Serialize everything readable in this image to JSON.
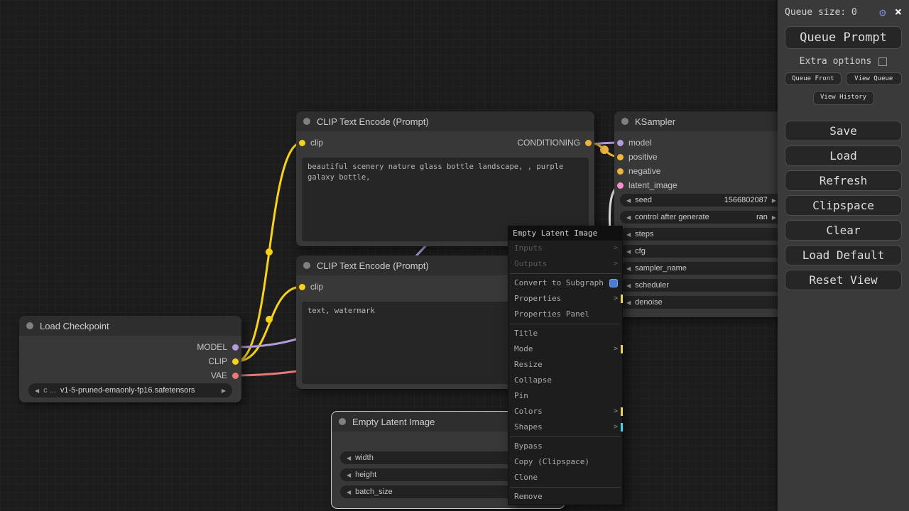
{
  "icons": {
    "gear": "⚙",
    "close": "×",
    "arrow_left": "◀",
    "arrow_right": "▶",
    "submenu_arrow": ">"
  },
  "sidebar": {
    "queue_size": "Queue size: 0",
    "queue_prompt": "Queue Prompt",
    "extra_options": "Extra options",
    "queue_front": "Queue Front",
    "view_queue": "View Queue",
    "view_history": "View History",
    "actions": [
      {
        "label": "Save"
      },
      {
        "label": "Load"
      },
      {
        "label": "Refresh"
      },
      {
        "label": "Clipspace"
      },
      {
        "label": "Clear"
      },
      {
        "label": "Load Default"
      },
      {
        "label": "Reset View"
      }
    ]
  },
  "nodes": {
    "clip_encode_positive": {
      "title": "CLIP Text Encode (Prompt)",
      "input_label": "clip",
      "output_label": "CONDITIONING",
      "text": "beautiful scenery nature glass bottle landscape, , purple galaxy bottle,"
    },
    "clip_encode_negative": {
      "title": "CLIP Text Encode (Prompt)",
      "input_label": "clip",
      "text": "text, watermark"
    },
    "ksampler": {
      "title": "KSampler",
      "inputs": [
        {
          "label": "model"
        },
        {
          "label": "positive"
        },
        {
          "label": "negative"
        },
        {
          "label": "latent_image"
        }
      ],
      "widgets": [
        {
          "label": "seed",
          "value": "1566802087"
        },
        {
          "label": "control after generate",
          "value": "ran"
        },
        {
          "label": "steps",
          "value": ""
        },
        {
          "label": "cfg",
          "value": ""
        },
        {
          "label": "sampler_name",
          "value": ""
        },
        {
          "label": "scheduler",
          "value": ""
        },
        {
          "label": "denoise",
          "value": ""
        }
      ]
    },
    "load_checkpoint": {
      "title": "Load Checkpoint",
      "outputs": [
        {
          "label": "MODEL"
        },
        {
          "label": "CLIP"
        },
        {
          "label": "VAE"
        }
      ],
      "widget": {
        "label": "c ...",
        "value": "v1-5-pruned-emaonly-fp16.safetensors"
      }
    },
    "empty_latent": {
      "title": "Empty Latent Image",
      "widgets": [
        {
          "label": "width"
        },
        {
          "label": "height"
        },
        {
          "label": "batch_size"
        }
      ]
    }
  },
  "context_menu": {
    "title": "Empty Latent Image",
    "items": [
      {
        "label": "Inputs"
      },
      {
        "label": "Outputs"
      },
      {
        "label": "Convert to Subgraph"
      },
      {
        "label": "Properties"
      },
      {
        "label": "Properties Panel"
      },
      {
        "label": "Title"
      },
      {
        "label": "Mode"
      },
      {
        "label": "Resize"
      },
      {
        "label": "Collapse"
      },
      {
        "label": "Pin"
      },
      {
        "label": "Colors"
      },
      {
        "label": "Shapes"
      },
      {
        "label": "Bypass"
      },
      {
        "label": "Copy (Clipspace)"
      },
      {
        "label": "Clone"
      },
      {
        "label": "Remove"
      }
    ]
  },
  "colors": {
    "model": "#b39ddb",
    "clip": "#f7d11a",
    "vae": "#e87a7a",
    "conditioning": "#f0b53c",
    "latent": "#f78fd0",
    "accent_yellow": "#e8d44d",
    "accent_cyan": "#3fd6e8"
  }
}
